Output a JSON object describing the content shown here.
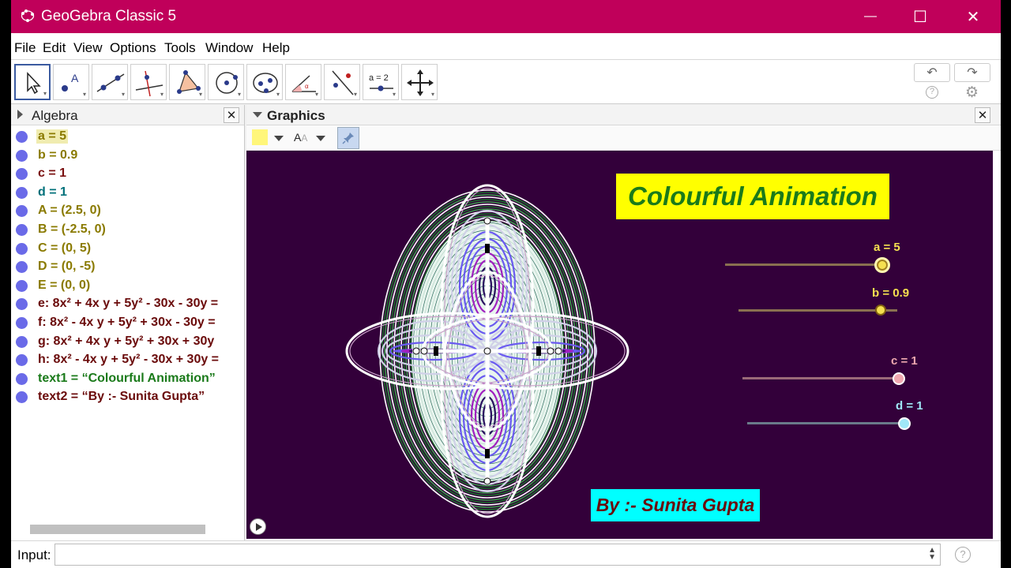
{
  "window": {
    "title": "GeoGebra Classic 5",
    "minimize": "—",
    "maximize": "☐",
    "close": "✕"
  },
  "menu": [
    "File",
    "Edit",
    "View",
    "Options",
    "Tools",
    "Window",
    "Help"
  ],
  "toolbar": {
    "tools": [
      "move-tool",
      "point-tool",
      "line-tool",
      "perpendicular-tool",
      "polygon-tool",
      "circle-tool",
      "ellipse-tool",
      "angle-tool",
      "reflect-tool",
      "slider-tool",
      "move-view-tool"
    ],
    "slider_tool_label": "a = 2",
    "undo": "↶",
    "redo": "↷",
    "help": "?",
    "settings": "⚙"
  },
  "algebra": {
    "title": "Algebra",
    "items": [
      {
        "text": "a = 5",
        "color": "#8a7a00",
        "selected": true
      },
      {
        "text": "b = 0.9",
        "color": "#8a7a00",
        "selected": false
      },
      {
        "text": "c = 1",
        "color": "#7a1010",
        "selected": false
      },
      {
        "text": "d = 1",
        "color": "#00707a",
        "selected": false
      },
      {
        "text": "A = (2.5, 0)",
        "color": "#8a7a00",
        "selected": false
      },
      {
        "text": "B = (-2.5, 0)",
        "color": "#8a7a00",
        "selected": false
      },
      {
        "text": "C = (0, 5)",
        "color": "#8a7a00",
        "selected": false
      },
      {
        "text": "D = (0, -5)",
        "color": "#8a7a00",
        "selected": false
      },
      {
        "text": "E = (0, 0)",
        "color": "#8a7a00",
        "selected": false
      },
      {
        "text": "e: 8x² + 4x y + 5y² - 30x - 30y =",
        "color": "#6a0a0a",
        "selected": false
      },
      {
        "text": "f: 8x² - 4x y + 5y² + 30x - 30y =",
        "color": "#6a0a0a",
        "selected": false
      },
      {
        "text": "g: 8x² + 4x y + 5y² + 30x + 30y",
        "color": "#6a0a0a",
        "selected": false
      },
      {
        "text": "h: 8x² - 4x y + 5y² - 30x + 30y =",
        "color": "#6a0a0a",
        "selected": false
      },
      {
        "text": "text1 = “Colourful Animation”",
        "color": "#1a7a1a",
        "selected": false
      },
      {
        "text": "text2 = “By :- Sunita Gupta”",
        "color": "#6a0a0a",
        "selected": false
      }
    ]
  },
  "graphics": {
    "title": "Graphics",
    "text1": "Colourful Animation",
    "text2": "By :- Sunita Gupta",
    "sliders": [
      {
        "label": "a = 5",
        "color": "#f5e050",
        "track": "#8a7050"
      },
      {
        "label": "b = 0.9",
        "color": "#f5e050",
        "track": "#8a7050"
      },
      {
        "label": "c = 1",
        "color": "#f0a8b0",
        "track": "#9a6a78"
      },
      {
        "label": "d = 1",
        "color": "#a0e8f8",
        "track": "#6a7a8a"
      }
    ],
    "bg": "#33003a"
  },
  "input": {
    "label": "Input:",
    "help": "?"
  }
}
